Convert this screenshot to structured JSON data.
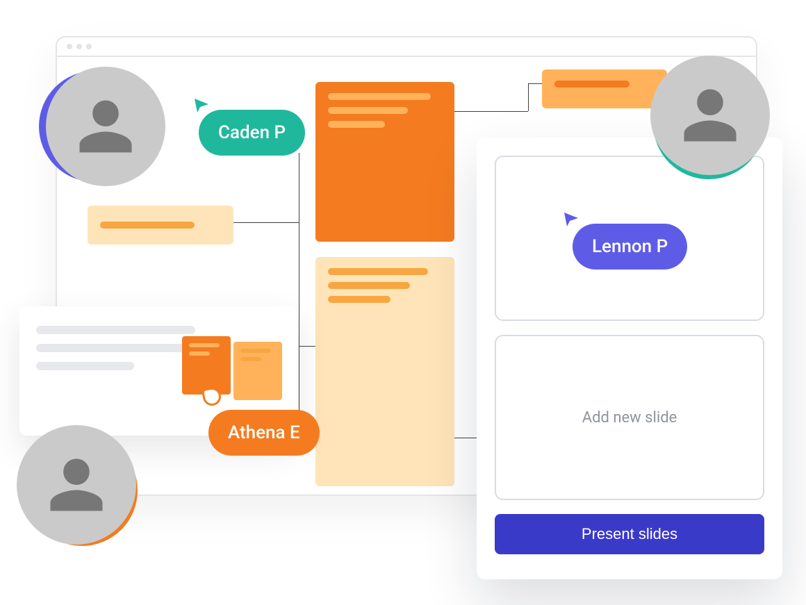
{
  "cursors": {
    "caden": {
      "label": "Caden P",
      "color": "#20B89C"
    },
    "athena": {
      "label": "Athena E",
      "color": "#F47B20"
    },
    "lennon": {
      "label": "Lennon P",
      "color": "#5E5CE6"
    }
  },
  "slides": {
    "add_label": "Add new slide",
    "present_label": "Present slides"
  },
  "colors": {
    "indigo": "#5E5CE6",
    "teal": "#20B89C",
    "orange": "#F47B20",
    "amber": "#FFB259",
    "cream": "#FEE4B8",
    "deepblue": "#3a3ac9"
  }
}
